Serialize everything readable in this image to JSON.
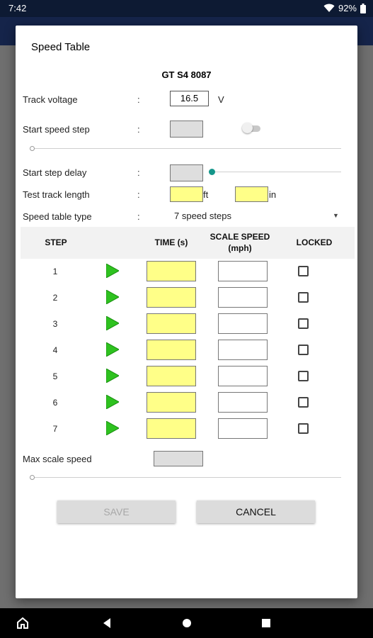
{
  "status_bar": {
    "time": "7:42",
    "battery": "92%"
  },
  "dialog": {
    "title": "Speed Table",
    "loco_name": "GT S4 8087",
    "track_voltage": {
      "label": "Track voltage",
      "colon": ":",
      "value": "16.5",
      "unit": "V"
    },
    "start_speed_step": {
      "label": "Start speed step",
      "colon": ":",
      "toggle_on": false
    },
    "start_step_delay": {
      "label": "Start step delay",
      "colon": ":"
    },
    "test_track_length": {
      "label": "Test track length",
      "colon": ":",
      "unit_ft": "ft",
      "unit_in": "in"
    },
    "speed_table_type": {
      "label": "Speed table type",
      "colon": ":",
      "selected": "7 speed steps"
    },
    "table": {
      "headers": {
        "step": "STEP",
        "time": "TIME (s)",
        "scale_speed_1": "SCALE SPEED",
        "scale_speed_2": "(mph)",
        "locked": "LOCKED"
      },
      "rows": [
        {
          "step": "1"
        },
        {
          "step": "2"
        },
        {
          "step": "3"
        },
        {
          "step": "4"
        },
        {
          "step": "5"
        },
        {
          "step": "6"
        },
        {
          "step": "7"
        }
      ]
    },
    "max_scale_speed": {
      "label": "Max scale speed"
    },
    "buttons": {
      "save": "SAVE",
      "cancel": "CANCEL"
    }
  },
  "colors": {
    "yellow_field": "#ffff88",
    "play_green": "#2ec21f",
    "accent_teal": "#14968a",
    "app_bar": "#15244a"
  },
  "icons": {
    "wifi": "wifi-icon",
    "battery": "battery-icon",
    "play": "play-icon",
    "home": "home-icon",
    "back": "back-icon",
    "circle": "home-circle-icon",
    "square": "recents-icon"
  }
}
